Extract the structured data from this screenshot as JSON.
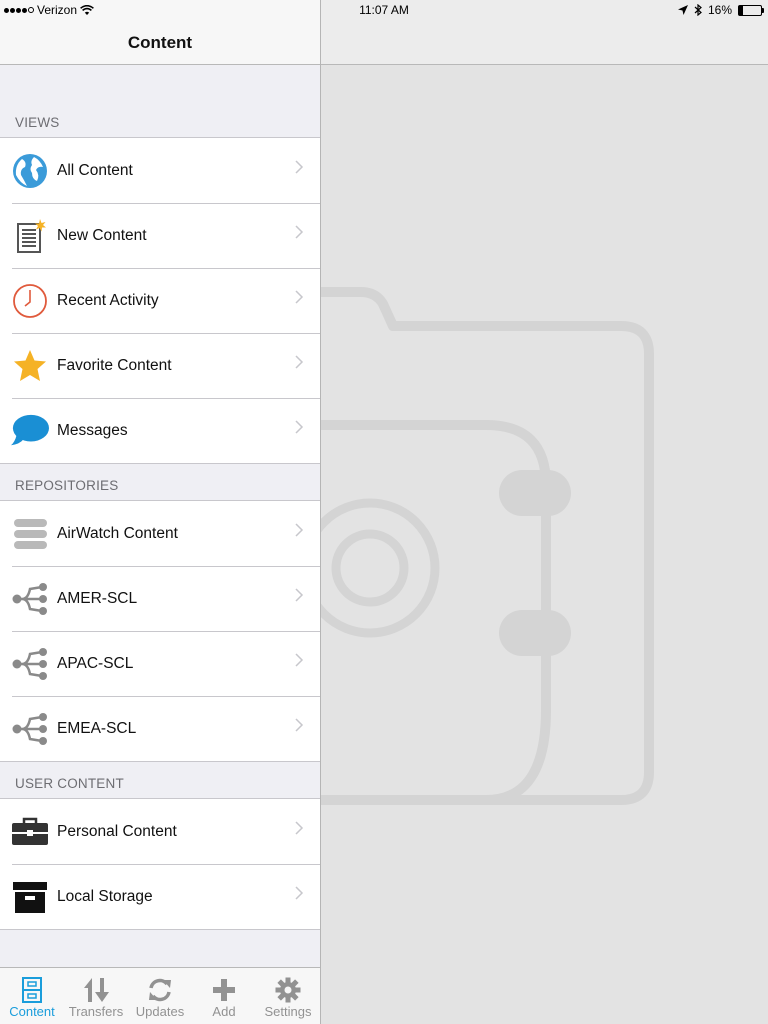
{
  "status_bar": {
    "carrier": "Verizon",
    "time": "11:07 AM",
    "battery": "16%",
    "battery_level": 0.16,
    "icons": [
      "signal-dots-icon",
      "wifi-icon",
      "location-arrow-icon",
      "bluetooth-icon",
      "battery-icon"
    ]
  },
  "nav": {
    "title": "Content"
  },
  "sections": [
    {
      "header": "VIEWS",
      "items": [
        {
          "label": "All Content",
          "icon": "globe-icon",
          "color": "#3b9bd9"
        },
        {
          "label": "New Content",
          "icon": "new-document-icon",
          "color": "#555555"
        },
        {
          "label": "Recent Activity",
          "icon": "clock-icon",
          "color": "#e05a3c"
        },
        {
          "label": "Favorite Content",
          "icon": "star-icon",
          "color": "#f5b225"
        },
        {
          "label": "Messages",
          "icon": "speech-bubble-icon",
          "color": "#1a8fd4"
        }
      ]
    },
    {
      "header": "REPOSITORIES",
      "items": [
        {
          "label": "AirWatch Content",
          "icon": "database-icon",
          "color": "#b9b9b9"
        },
        {
          "label": "AMER-SCL",
          "icon": "network-share-icon",
          "color": "#8a8a8a"
        },
        {
          "label": "APAC-SCL",
          "icon": "network-share-icon",
          "color": "#8a8a8a"
        },
        {
          "label": "EMEA-SCL",
          "icon": "network-share-icon",
          "color": "#8a8a8a"
        }
      ]
    },
    {
      "header": "USER CONTENT",
      "items": [
        {
          "label": "Personal Content",
          "icon": "briefcase-icon",
          "color": "#333333"
        },
        {
          "label": "Local Storage",
          "icon": "archive-box-icon",
          "color": "#111111"
        }
      ]
    }
  ],
  "tab_bar": {
    "tabs": [
      {
        "label": "Content",
        "icon": "content-cabinet-icon",
        "active": true
      },
      {
        "label": "Transfers",
        "icon": "transfer-arrows-icon",
        "active": false
      },
      {
        "label": "Updates",
        "icon": "refresh-icon",
        "active": false
      },
      {
        "label": "Add",
        "icon": "plus-icon",
        "active": false
      },
      {
        "label": "Settings",
        "icon": "gear-icon",
        "active": false
      }
    ],
    "active_color": "#1a9ddb",
    "inactive_color": "#929292"
  },
  "detail": {
    "placeholder_icon": "content-locker-placeholder-icon"
  }
}
